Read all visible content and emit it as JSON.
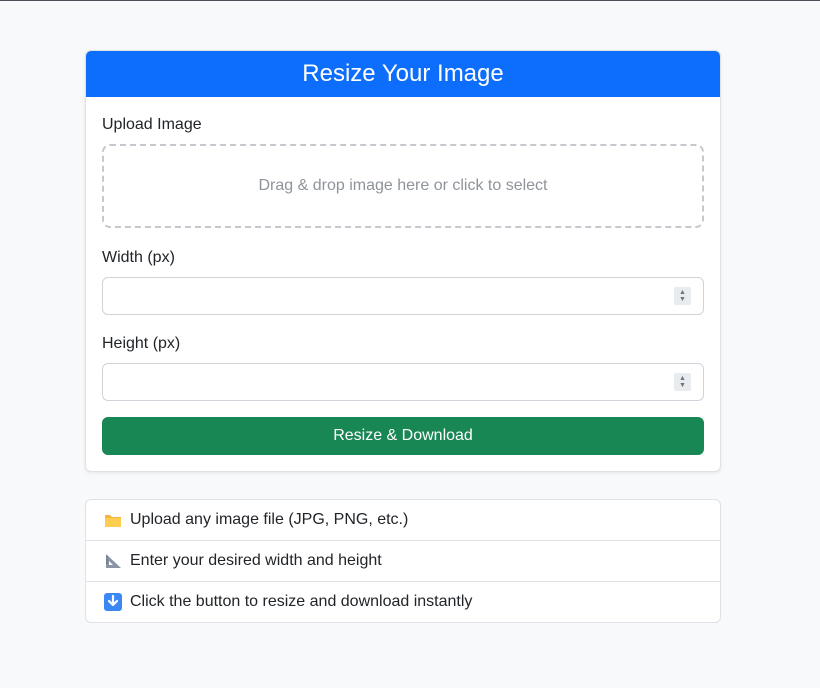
{
  "card": {
    "title": "Resize Your Image",
    "upload_label": "Upload Image",
    "dropzone_text": "Drag & drop image here or click to select",
    "width_label": "Width (px)",
    "height_label": "Height (px)",
    "width_value": "",
    "height_value": "",
    "submit_label": "Resize & Download"
  },
  "instructions": [
    {
      "icon": "folder-icon",
      "text": "Upload any image file (JPG, PNG, etc.)"
    },
    {
      "icon": "triangular-ruler-icon",
      "text": "Enter your desired width and height"
    },
    {
      "icon": "down-arrow-icon",
      "text": "Click the button to resize and download instantly"
    }
  ],
  "colors": {
    "header": "#0d6efd",
    "button": "#198754",
    "background": "#f8f9fa"
  }
}
